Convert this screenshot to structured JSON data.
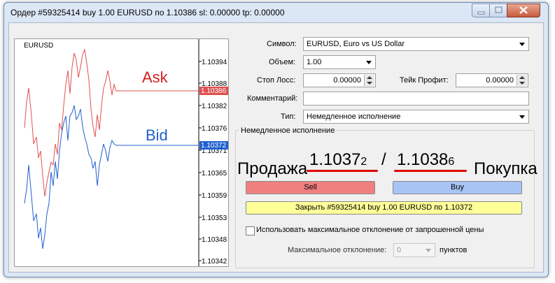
{
  "window": {
    "title": "Ордер #59325414 buy 1.00 EURUSD по 1.10386 sl: 0.00000 tp: 0.00000"
  },
  "chart": {
    "symbol": "EURUSD",
    "ask_label": "Ask",
    "bid_label": "Bid",
    "ask_price": "1.10386",
    "bid_price": "1.10372",
    "ask_color": "#e05050",
    "bid_color": "#2060d0",
    "yticks": [
      "1.10394",
      "1.10388",
      "1.10382",
      "1.10376",
      "1.10371",
      "1.10365",
      "1.10359",
      "1.10353",
      "1.10348",
      "1.10342"
    ]
  },
  "form": {
    "symbol_label": "Символ:",
    "symbol_value": "EURUSD, Euro vs US Dollar",
    "volume_label": "Объем:",
    "volume_value": "1.00",
    "sl_label": "Стоп Лосс:",
    "sl_value": "0.00000",
    "tp_label": "Тейк Профит:",
    "tp_value": "0.00000",
    "comment_label": "Комментарий:",
    "comment_value": "",
    "type_label": "Тип:",
    "type_value": "Немедленное исполнение"
  },
  "execution": {
    "group_title": "Немедленное исполнение",
    "sell_text": "Продажа",
    "buy_text": "Покупка",
    "bid_main": "1.1037",
    "bid_last": "2",
    "ask_main": "1.1038",
    "ask_last": "6",
    "separator": "/",
    "sell_button": "Sell",
    "buy_button": "Buy",
    "close_button": "Закрыть #59325414 buy 1.00 EURUSD по 1.10372",
    "max_dev_checkbox": "Использовать максимальное отклонение от запрошенной цены",
    "max_dev_label": "Максимальное отклонение:",
    "max_dev_value": "0",
    "points_label": "пунктов"
  }
}
